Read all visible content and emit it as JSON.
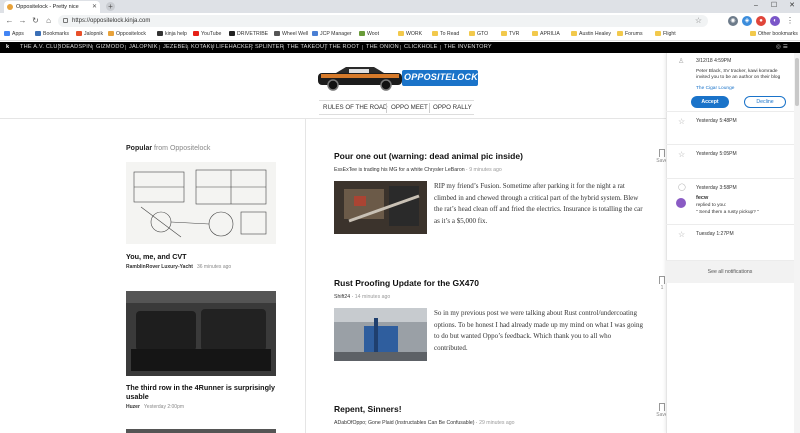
{
  "browser": {
    "tab_title": "Oppositelock - Pretty nice",
    "url": "https://oppositelock.kinja.com",
    "bookmarks": [
      {
        "label": "Apps",
        "color": "#4285f4"
      },
      {
        "label": "Bookmarks",
        "color": "#3b6fb6"
      },
      {
        "label": "Jalopnik",
        "color": "#e8502a"
      },
      {
        "label": "Oppositelock",
        "color": "#e8a23a"
      },
      {
        "label": "kinja help",
        "color": "#333333"
      },
      {
        "label": "YouTube",
        "color": "#e62117"
      },
      {
        "label": "DRIVETRIBE",
        "color": "#222222"
      },
      {
        "label": "Wheel Well",
        "color": "#555555"
      },
      {
        "label": "JCP Manager",
        "color": "#4a7fd4"
      },
      {
        "label": "Woot",
        "color": "#6a9c3a"
      },
      {
        "label": "WORK",
        "color": "#f2c94c"
      },
      {
        "label": "To Read",
        "color": "#f2c94c"
      },
      {
        "label": "GTO",
        "color": "#f2c94c"
      },
      {
        "label": "TVR",
        "color": "#f2c94c"
      },
      {
        "label": "APRILIA",
        "color": "#f2c94c"
      },
      {
        "label": "Austin Healey",
        "color": "#f2c94c"
      },
      {
        "label": "Forums",
        "color": "#f2c94c"
      },
      {
        "label": "Flight",
        "color": "#f2c94c"
      },
      {
        "label": "Other bookmarks",
        "color": "#f2c94c"
      }
    ]
  },
  "kinja_nav": [
    "THE A.V. CLUB",
    "DEADSPIN",
    "GIZMODO",
    "JALOPNIK",
    "JEZEBEL",
    "KOTAKU",
    "LIFEHACKER",
    "SPLINTER",
    "THE TAKEOUT",
    "THE ROOT",
    "THE ONION",
    "CLICKHOLE",
    "THE INVENTORY"
  ],
  "site": {
    "logo_text": "OPPOSITELOCK",
    "subnav": [
      "RULES OF THE ROAD",
      "OPPO MEET",
      "OPPO RALLY"
    ]
  },
  "popular": {
    "title": "Popular",
    "from": "from Oppositelock",
    "cards": [
      {
        "title": "You, me, and CVT",
        "author": "RamblinRover Luxury-Yacht",
        "time": "36 minutes ago"
      },
      {
        "title": "The third row in the 4Runner is surprisingly usable",
        "author": "Huzer",
        "time": "Yesterday 2:00pm"
      }
    ]
  },
  "posts": [
    {
      "title": "Pour one out (warning: dead animal pic inside)",
      "author": "EssExTee is trading his MG for a white Chrysler LeBaron",
      "time": "9 minutes ago",
      "excerpt": "RIP my friend’s Fusion. Sometime after parking it for the night a rat climbed in and chewed through a critical part of the hybrid system. Blew the rat’s head clean off and fried the electrics. Insurance is totalling the car as it’s a $5,000 fix.",
      "save": "Save"
    },
    {
      "title": "Rust Proofing Update for the GX470",
      "author": "Shift24",
      "time": "14 minutes ago",
      "excerpt": "So in my previous post we were talking about Rust control/undercoating options. To be honest I had already made up my mind on what I was going to do but wanted Oppo’s feedback. Which thank you to all who contributed.",
      "save": "1"
    },
    {
      "title": "Repent, Sinners!",
      "author": "ADabOfOppo; Gone Plaid (Instructables Can Be Confusable)",
      "time": "29 minutes ago",
      "save": "Save"
    }
  ],
  "notifications": {
    "invite": {
      "time": "3/12/18 4:59PM",
      "text": "Peter Black, SV tracker, kawi komrade invited you to be an author on their blog",
      "blog": "The Cigar Lounge",
      "accept": "Accept",
      "decline": "Decline"
    },
    "items": [
      {
        "time": "Yesterday 5:48PM"
      },
      {
        "time": "Yesterday 5:05PM"
      },
      {
        "time": "Yesterday 3:58PM",
        "user": "fecw",
        "action": "replied to you:",
        "quote": "\" Send them a rusty pickup? \""
      },
      {
        "time": "Tuesday 1:27PM"
      }
    ],
    "see_all": "See all notifications"
  },
  "colors": {
    "accent": "#1a73c9",
    "kinja_bar": "#000000",
    "logo_blue": "#1a73c9"
  }
}
